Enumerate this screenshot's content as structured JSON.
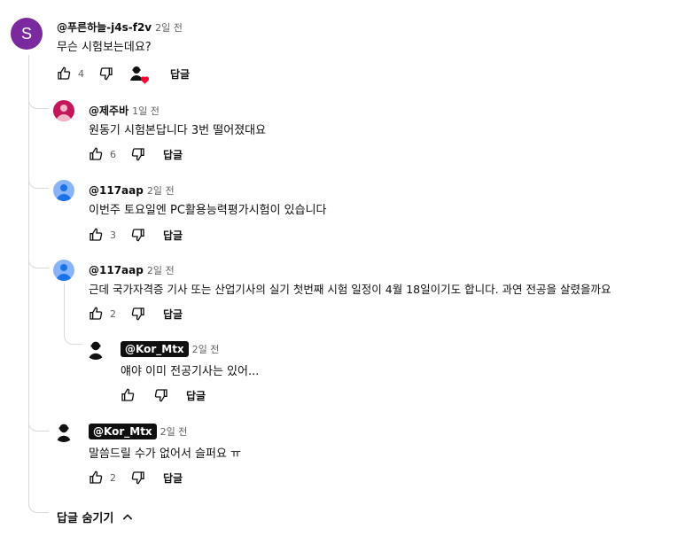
{
  "comment": {
    "author": "@푸른하늘-j4s-f2v",
    "time": "2일 전",
    "avatar_letter": "S",
    "text": "무슨 시험보는데요?",
    "likes": "4",
    "reply_label": "답글",
    "hearted": true
  },
  "replies": [
    {
      "author": "@제주바",
      "time": "1일 전",
      "text": "원동기 시험본답니다  3번 떨어졌대요",
      "likes": "6",
      "reply_label": "답글",
      "avatar_color": "#c2185b"
    },
    {
      "author": "@117aap",
      "time": "2일 전",
      "text": "이번주 토요일엔 PC활용능력평가시험이 있습니다",
      "likes": "3",
      "reply_label": "답글",
      "avatar_color": "#8ab4f8"
    },
    {
      "author": "@117aap",
      "time": "2일 전",
      "text": "근데 국가자격증 기사 또는 산업기사의 실기 첫번째 시험 일정이 4월 18일이기도 합니다. 과연 전공을 살렸을까요",
      "likes": "2",
      "reply_label": "답글",
      "avatar_color": "#8ab4f8"
    },
    {
      "author": "@Kor_Mtx",
      "time": "2일 전",
      "text": "얘야 이미 전공기사는 있어...",
      "likes": "",
      "reply_label": "답글",
      "badge": true
    },
    {
      "author": "@Kor_Mtx",
      "time": "2일 전",
      "text": "말씀드릴 수가 없어서 슬퍼요 ㅠ",
      "likes": "2",
      "reply_label": "답글",
      "badge": true
    }
  ],
  "hide_replies_label": "답글 숨기기"
}
